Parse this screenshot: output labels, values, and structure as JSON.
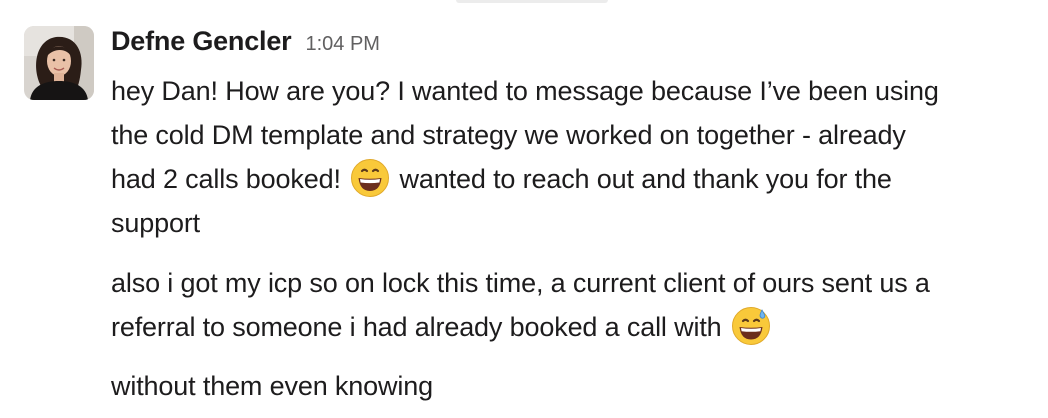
{
  "message": {
    "sender": "Defne Gencler",
    "timestamp": "1:04 PM",
    "paragraphs": [
      {
        "lines": [
          "hey Dan! How are you? I wanted to message because I’ve been using",
          "the cold DM template and strategy we worked on together - already",
          "had 2 calls booked!",
          "wanted to reach out and thank you for the",
          "support"
        ],
        "emoji": "grinning-face-icon"
      },
      {
        "lines": [
          "also i got my icp so on lock this time, a current client of ours sent us a",
          "referral to someone i had already booked a call with"
        ],
        "emoji": "grinning-face-with-sweat-icon"
      },
      {
        "lines": [
          "without them even knowing"
        ]
      }
    ]
  },
  "colors": {
    "text": "#1d1c1d",
    "timestamp": "#616061",
    "emoji_face": "#f9c93a"
  }
}
